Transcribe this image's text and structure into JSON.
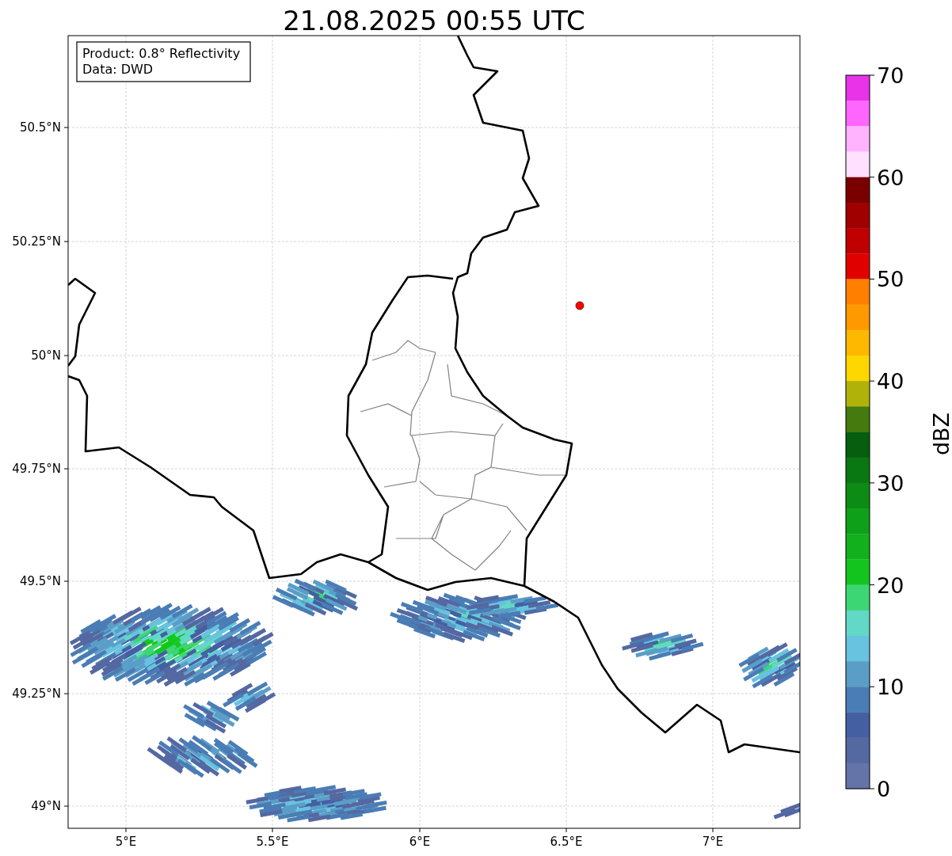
{
  "title": "21.08.2025 00:55 UTC",
  "info_box": {
    "lines": [
      "Product: 0.8° Reflectivity",
      "Data: DWD"
    ]
  },
  "map": {
    "x_ticks": [
      "5°E",
      "5.5°E",
      "6°E",
      "6.5°E",
      "7°E"
    ],
    "y_ticks": [
      "50.5°N",
      "50.25°N",
      "50°N",
      "49.75°N",
      "49.5°N",
      "49.25°N",
      "49°N"
    ]
  },
  "colorbar": {
    "label": "dBZ",
    "ticks": [
      "70",
      "60",
      "50",
      "40",
      "30",
      "20",
      "10",
      "0"
    ],
    "bins": [
      {
        "color": "#e833e8"
      },
      {
        "color": "#ff66ff"
      },
      {
        "color": "#ffb3ff"
      },
      {
        "color": "#ffe0ff"
      },
      {
        "color": "#7a0000"
      },
      {
        "color": "#a00000"
      },
      {
        "color": "#c00000"
      },
      {
        "color": "#e00000"
      },
      {
        "color": "#ff7f00"
      },
      {
        "color": "#ff9900"
      },
      {
        "color": "#ffb800"
      },
      {
        "color": "#ffd700"
      },
      {
        "color": "#b0b20a"
      },
      {
        "color": "#457a0e"
      },
      {
        "color": "#065e0e"
      },
      {
        "color": "#0a7812"
      },
      {
        "color": "#0c8c14"
      },
      {
        "color": "#0ea018"
      },
      {
        "color": "#12b01c"
      },
      {
        "color": "#14c41e"
      },
      {
        "color": "#3dd675"
      },
      {
        "color": "#62d8c6"
      },
      {
        "color": "#67c3df"
      },
      {
        "color": "#5a9ec8"
      },
      {
        "color": "#4a7db5"
      },
      {
        "color": "#4460a3"
      },
      {
        "color": "#5468a2"
      },
      {
        "color": "#6474a8"
      }
    ]
  }
}
